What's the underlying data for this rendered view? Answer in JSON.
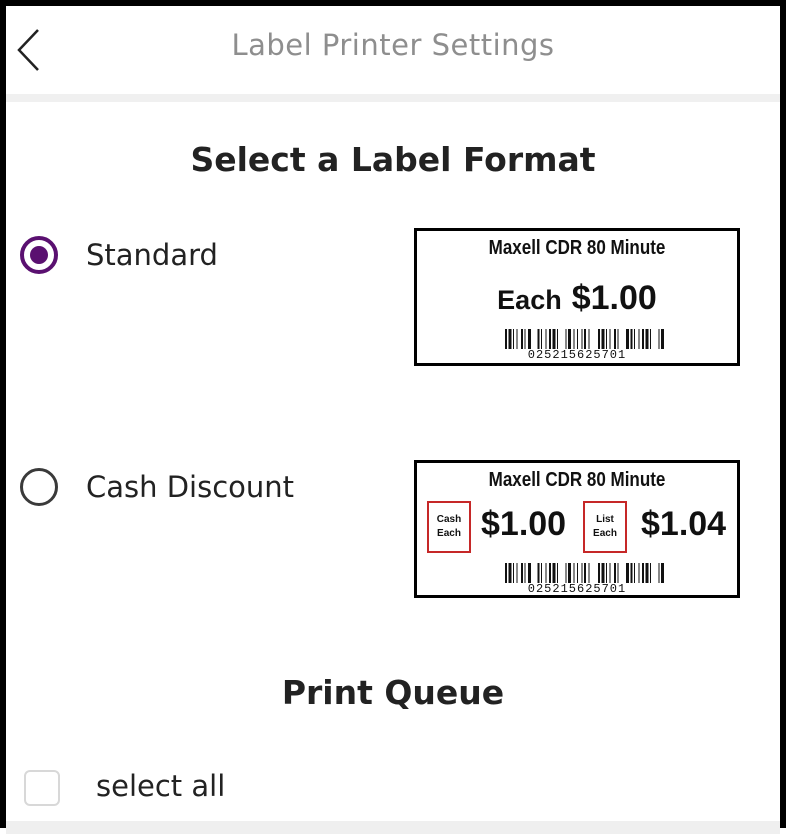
{
  "header": {
    "title": "Label Printer Settings",
    "back_icon": "chevron-left-icon"
  },
  "format_section": {
    "title": "Select a Label Format"
  },
  "options": [
    {
      "label": "Standard",
      "selected": true
    },
    {
      "label": "Cash Discount",
      "selected": false
    }
  ],
  "previews": {
    "standard": {
      "product": "Maxell CDR 80 Minute",
      "each_label": "Each",
      "price": "$1.00",
      "barcode_number": "025215625701"
    },
    "cash_discount": {
      "product": "Maxell CDR 80 Minute",
      "cash_tag_line1": "Cash",
      "cash_tag_line2": "Each",
      "cash_price": "$1.00",
      "list_tag_line1": "List",
      "list_tag_line2": "Each",
      "list_price": "$1.04",
      "barcode_number": "025215625701"
    }
  },
  "queue_section": {
    "title": "Print Queue",
    "select_all_label": "select all",
    "select_all_checked": false
  },
  "colors": {
    "accent": "#5a1070",
    "tag_border": "#c62828",
    "title_gray": "#8e8e8e"
  }
}
